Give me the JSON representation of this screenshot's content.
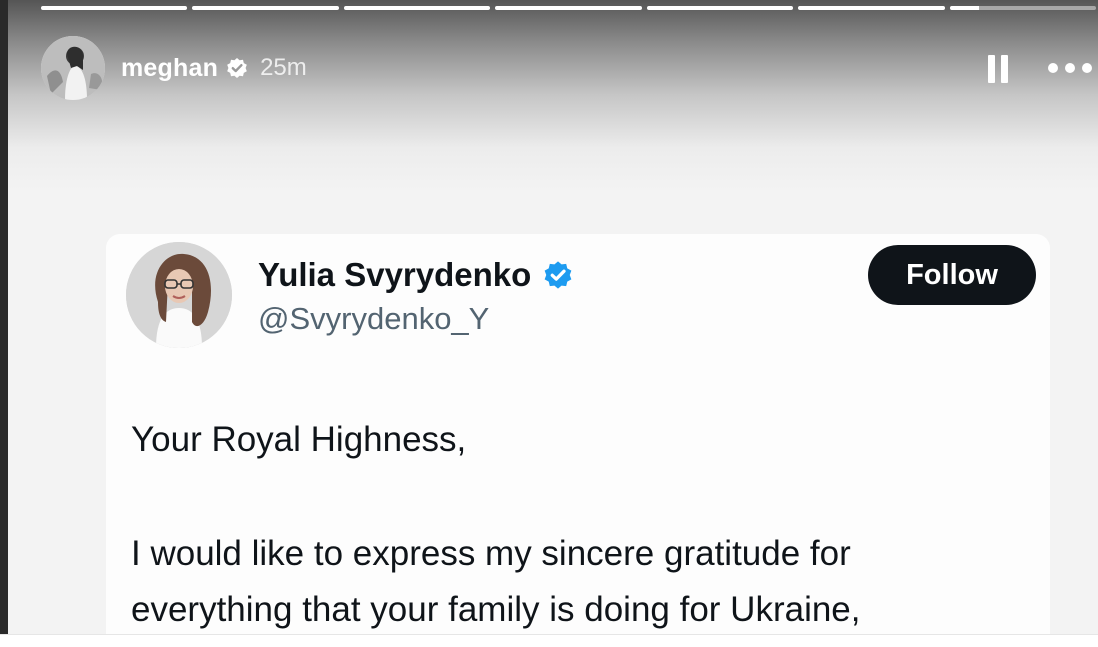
{
  "story": {
    "progress": [
      1,
      1,
      1,
      1,
      1,
      1,
      0.2
    ],
    "username": "meghan",
    "time_ago": "25m",
    "icons": {
      "verified": "verified-badge-icon",
      "pause": "pause-icon",
      "more": "more-options-icon"
    }
  },
  "tweet": {
    "author_name": "Yulia Svyrydenko",
    "handle": "@Svyrydenko_Y",
    "follow_label": "Follow",
    "body_lines": [
      "Your Royal Highness,",
      "I would like to express my sincere gratitude for",
      "everything that your family is doing for Ukraine,"
    ]
  },
  "colors": {
    "verified_blue": "#1d9bf0",
    "text": "#0f1419",
    "handle": "#536471"
  }
}
